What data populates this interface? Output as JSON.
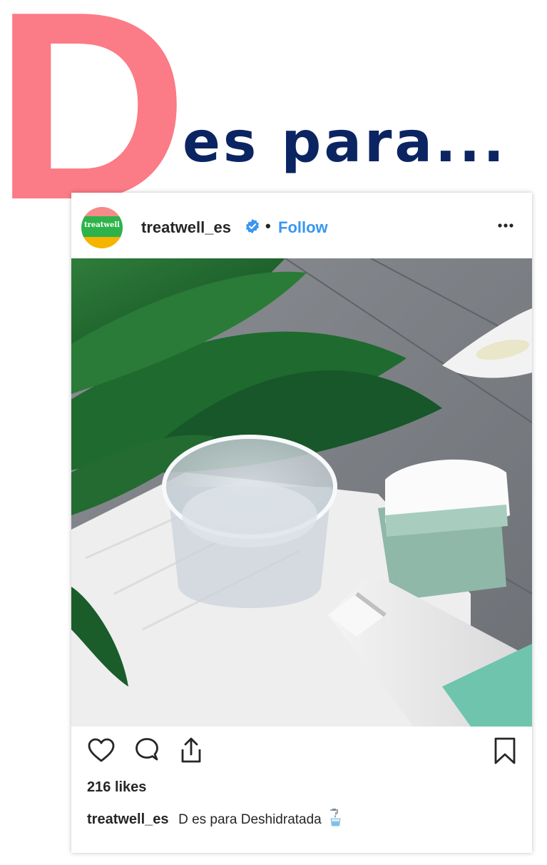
{
  "headline": {
    "letter": "D",
    "text": "es para..."
  },
  "post": {
    "username": "treatwell_es",
    "avatar_label": "treatwell",
    "separator": "•",
    "follow_label": "Follow",
    "likes_count": "216",
    "likes_word": "likes",
    "caption_user": "treatwell_es",
    "caption_text": "D es para Deshidratada",
    "caption_emoji_icon": "potable-water-icon"
  },
  "icons": {
    "verified": "verified-badge-icon",
    "more": "more-options-icon",
    "like": "heart-icon",
    "comment": "comment-icon",
    "share": "share-icon",
    "save": "bookmark-icon"
  },
  "colors": {
    "pink": "#fb7b86",
    "navy": "#0b2462",
    "link_blue": "#3897f0",
    "text": "#262626"
  }
}
